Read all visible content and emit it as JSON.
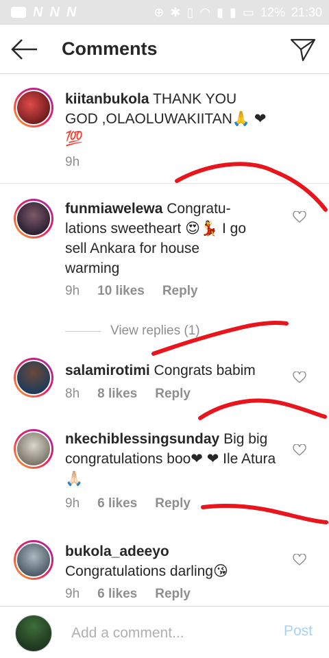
{
  "status_bar": {
    "left_glyphs": [
      "N",
      "N",
      "N"
    ],
    "battery": "12%",
    "time": "21:30"
  },
  "header": {
    "title": "Comments",
    "back_icon": "arrow-left-icon",
    "send_icon": "paper-plane-icon"
  },
  "comments": [
    {
      "username": "kiitanbukola",
      "text": " THANK YOU GOD ,OLAOLUWAKIITAN🙏 ❤💯",
      "time": "9h",
      "likes": "",
      "reply_label": "",
      "avatar_color": "#b52b2b",
      "pinned": true
    },
    {
      "username": "funmiawelewa",
      "text": " Congratu-lations sweetheart 😍💃 I go sell Ankara for house warming",
      "time": "9h",
      "likes": "10 likes",
      "reply_label": "Reply",
      "avatar_color": "#3b2a4a"
    },
    {
      "username": "salamirotimi",
      "text": " Congrats babim",
      "time": "8h",
      "likes": "8 likes",
      "reply_label": "Reply",
      "avatar_color": "#2b5f8a"
    },
    {
      "username": "nkechiblessingsunday",
      "text": " Big big congratulations boo❤ ❤  Ile Atura🙏🏻",
      "time": "9h",
      "likes": "6 likes",
      "reply_label": "Reply",
      "avatar_color": "#8a8a80"
    },
    {
      "username": "bukola_adeeyo",
      "text": " Congratulations darling😘",
      "time": "9h",
      "likes": "6 likes",
      "reply_label": "Reply",
      "avatar_color": "#5a6f7a"
    }
  ],
  "view_replies": "View replies (1)",
  "footer": {
    "placeholder": "Add a comment...",
    "post_label": "Post"
  },
  "colors": {
    "scribble": "#e8161c",
    "post_disabled": "#a9d0f5",
    "meta_gray": "#8e8e8e"
  }
}
